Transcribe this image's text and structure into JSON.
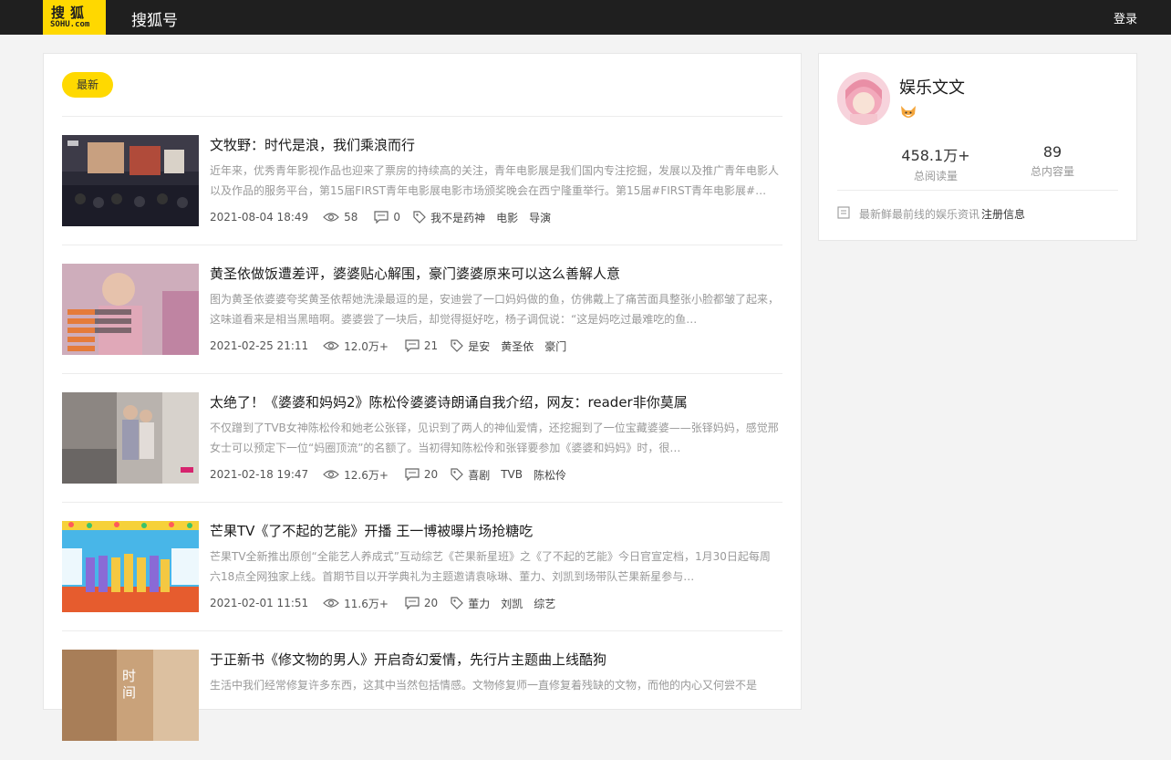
{
  "header": {
    "logo_cn": "搜狐",
    "logo_en": "SOHU.com",
    "site_name": "搜狐号",
    "login_label": "登录"
  },
  "tabs": [
    {
      "label": "最新",
      "active": true
    }
  ],
  "articles": [
    {
      "title": "文牧野：时代是浪，我们乘浪而行",
      "summary": "近年来，优秀青年影视作品也迎来了票房的持续高的关注，青年电影展是我们国内专注挖掘，发展以及推广青年电影人以及作品的服务平台，第15届FIRST青年电影展电影市场颁奖晚会在西宁隆重举行。第15届#FIRST青年电影展#…",
      "date": "2021-08-04 18:49",
      "views": "58",
      "comments": "0",
      "tags": [
        "我不是药神",
        "电影",
        "导演"
      ]
    },
    {
      "title": "黄圣依做饭遭差评，婆婆贴心解围，豪门婆婆原来可以这么善解人意",
      "summary": "图为黄圣依婆婆夸奖黄圣依帮她洗澡最逗的是，安迪尝了一口妈妈做的鱼，仿佛戴上了痛苦面具整张小脸都皱了起来，这味道看来是相当黑暗啊。婆婆尝了一块后，却觉得挺好吃，杨子调侃说：“这是妈吃过最难吃的鱼…",
      "date": "2021-02-25 21:11",
      "views": "12.0万+",
      "comments": "21",
      "tags": [
        "是安",
        "黄圣依",
        "豪门"
      ]
    },
    {
      "title": "太绝了！《婆婆和妈妈2》陈松伶婆婆诗朗诵自我介绍，网友：reader非你莫属",
      "summary": "不仅蹭到了TVB女神陈松伶和她老公张铎，见识到了两人的神仙爱情，还挖掘到了一位宝藏婆婆——张铎妈妈，感觉邢女士可以预定下一位“妈圈顶流”的名额了。当初得知陈松伶和张铎要参加《婆婆和妈妈》时，很…",
      "date": "2021-02-18 19:47",
      "views": "12.6万+",
      "comments": "20",
      "tags": [
        "喜剧",
        "TVB",
        "陈松伶"
      ]
    },
    {
      "title": "芒果TV《了不起的艺能》开播 王一博被曝片场抢糖吃",
      "summary": "芒果TV全新推出原创“全能艺人养成式”互动综艺《芒果新星班》之《了不起的艺能》今日官宣定档，1月30日起每周六18点全网独家上线。首期节目以开学典礼为主题邀请袁咏琳、董力、刘凯到场带队芒果新星参与…",
      "date": "2021-02-01 11:51",
      "views": "11.6万+",
      "comments": "20",
      "tags": [
        "董力",
        "刘凯",
        "综艺"
      ]
    },
    {
      "title": "于正新书《修文物的男人》开启奇幻爱情，先行片主题曲上线酷狗",
      "summary": "生活中我们经常修复许多东西，这其中当然包括情感。文物修复师一直修复着残缺的文物，而他的内心又何尝不是",
      "thumb_text": "时间",
      "date": "",
      "views": "",
      "comments": "",
      "tags": []
    }
  ],
  "sidebar": {
    "author_name": "娱乐文文",
    "stats": [
      {
        "value": "458.1万+",
        "label": "总阅读量"
      },
      {
        "value": "89",
        "label": "总内容量"
      }
    ],
    "intro": "最新鲜最前线的娱乐资讯",
    "register_label": "注册信息"
  },
  "colors": {
    "accent": "#ffd900",
    "header_bg": "#1f1f1f"
  }
}
